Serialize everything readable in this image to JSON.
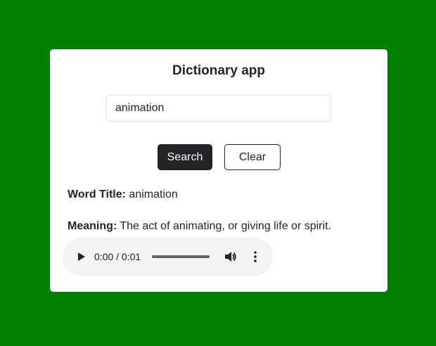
{
  "app": {
    "title": "Dictionary app"
  },
  "search": {
    "value": "animation",
    "search_label": "Search",
    "clear_label": "Clear"
  },
  "result": {
    "word_title_label": "Word Title:",
    "word_title_value": "animation",
    "meaning_label": "Meaning:",
    "meaning_value": "The act of animating, or giving life or spirit."
  },
  "audio": {
    "time_display": "0:00 / 0:01",
    "progress": 0,
    "icons": {
      "play": "play-icon",
      "volume": "volume-icon",
      "more": "more-options-icon"
    }
  },
  "colors": {
    "page_background": "#008000",
    "card_background": "#ffffff",
    "primary_button": "#212529",
    "audio_background": "#f1f3f4"
  }
}
